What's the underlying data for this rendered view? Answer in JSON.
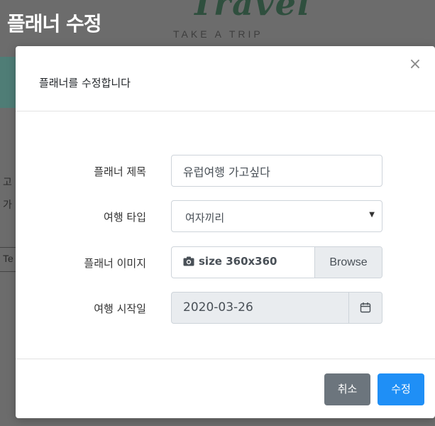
{
  "background": {
    "page_title": "플래너 수정",
    "logo_text": "Travel",
    "tagline": "TAKE A TRIP",
    "fragments": [
      "고",
      "가",
      "Te"
    ]
  },
  "modal": {
    "title": "플래너를 수정합니다",
    "close_icon": "×",
    "fields": {
      "title": {
        "label": "플래너 제목",
        "value": "유럽여행 가고싶다"
      },
      "type": {
        "label": "여행 타입",
        "value": "여자끼리"
      },
      "image": {
        "label": "플래너 이미지",
        "file_label": "size 360x360",
        "browse": "Browse"
      },
      "start_date": {
        "label": "여행 시작일",
        "value": "2020-03-26"
      }
    },
    "buttons": {
      "cancel": "취소",
      "save": "수정"
    }
  },
  "colors": {
    "primary": "#1f8ff6",
    "secondary": "#6c757d",
    "overlay": "#6c6c6c"
  }
}
